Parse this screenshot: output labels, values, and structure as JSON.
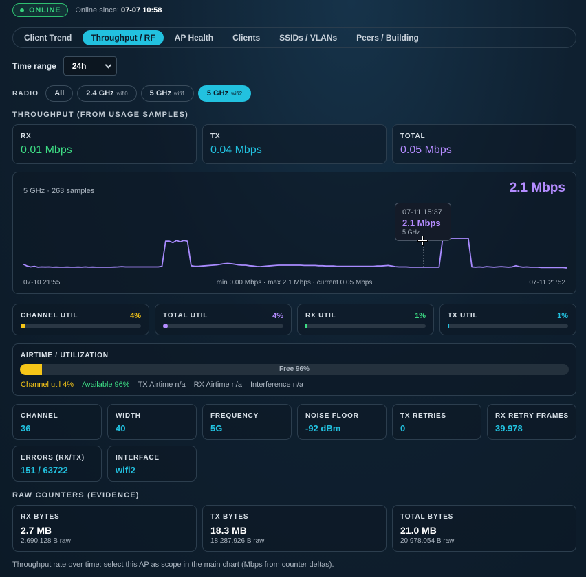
{
  "status": {
    "badge": "ONLINE",
    "since_label": "Online since:",
    "since_value": "07-07 10:58"
  },
  "tabs": [
    {
      "label": "Client Trend",
      "active": false
    },
    {
      "label": "Throughput / RF",
      "active": true
    },
    {
      "label": "AP Health",
      "active": false
    },
    {
      "label": "Clients",
      "active": false
    },
    {
      "label": "SSIDs / VLANs",
      "active": false
    },
    {
      "label": "Peers / Building",
      "active": false
    }
  ],
  "time_range": {
    "label": "Time range",
    "value": "24h"
  },
  "radio": {
    "label": "RADIO",
    "options": [
      {
        "label": "All",
        "sub": "",
        "active": false
      },
      {
        "label": "2.4 GHz",
        "sub": "wifi0",
        "active": false
      },
      {
        "label": "5 GHz",
        "sub": "wifi1",
        "active": false
      },
      {
        "label": "5 GHz",
        "sub": "wifi2",
        "active": true
      }
    ]
  },
  "throughput": {
    "title": "THROUGHPUT (FROM USAGE SAMPLES)",
    "rx": {
      "label": "RX",
      "value": "0.01 Mbps",
      "color": "#3ddc84"
    },
    "tx": {
      "label": "TX",
      "value": "0.04 Mbps",
      "color": "#22c1df"
    },
    "total": {
      "label": "TOTAL",
      "value": "0.05 Mbps",
      "color": "#b48cff"
    }
  },
  "chart": {
    "subtitle": "5 GHz · 263 samples",
    "peak": "2.1 Mbps",
    "tooltip": {
      "time": "07-11 15:37",
      "value": "2.1 Mbps",
      "band": "5 GHz"
    },
    "footer_left": "07-10 21:55",
    "footer_center": "min 0.00 Mbps · max 2.1 Mbps · current 0.05 Mbps",
    "footer_right": "07-11 21:52"
  },
  "chart_data": {
    "type": "line",
    "series": [
      {
        "values": [
          0.3,
          0.18,
          0.12,
          0.16,
          0.1,
          0.12,
          0.11,
          0.12,
          0.1,
          0.11,
          0.1,
          0.1,
          0.11,
          0.1,
          0.1,
          0.11,
          0.1,
          0.12,
          0.1,
          0.11,
          0.1,
          0.1,
          0.1,
          0.1,
          0.1,
          0.11,
          0.12,
          0.14,
          0.12,
          0.12,
          0.12,
          0.12,
          0.12,
          0.12,
          0.12,
          0.12,
          0.12,
          0.12,
          0.16,
          1.9,
          1.9,
          1.8,
          1.95,
          1.85,
          1.95,
          1.9,
          0.2,
          0.16,
          0.16,
          0.18,
          0.2,
          0.22,
          0.24,
          0.26,
          0.3,
          0.34,
          0.36,
          0.34,
          0.3,
          0.26,
          0.24,
          0.24,
          0.2,
          0.18,
          0.15,
          0.14,
          0.16,
          0.18,
          0.2,
          0.22,
          0.24,
          0.24,
          0.24,
          0.24,
          0.24,
          0.24,
          0.24,
          0.22,
          0.22,
          0.22,
          0.22,
          0.2,
          0.2,
          0.18,
          0.18,
          0.18,
          0.16,
          0.16,
          0.16,
          0.16,
          0.16,
          0.16,
          0.16,
          0.16,
          0.16,
          0.16,
          0.16,
          0.18,
          0.18,
          0.2,
          0.22,
          0.18,
          0.14,
          0.12,
          0.12,
          0.12,
          0.1,
          0.1,
          0.1,
          0.1,
          0.1,
          0.1,
          0.1,
          0.1,
          0.1,
          2.1,
          2.1,
          2.1,
          2.1,
          2.1,
          2.1,
          2.1,
          2.1,
          0.12,
          0.1,
          0.12,
          0.1,
          0.14,
          0.12,
          0.1,
          0.12,
          0.14,
          0.12,
          0.1,
          0.12,
          0.2,
          0.14,
          0.1,
          0.12,
          0.1,
          0.1,
          0.1,
          0.08,
          0.08,
          0.08,
          0.08,
          0.08,
          0.08,
          0.08,
          0.05
        ],
        "color": "#a98bff"
      }
    ],
    "x_start": "07-10 21:55",
    "x_end": "07-11 21:52",
    "ylim": [
      0,
      2.1
    ]
  },
  "util": [
    {
      "label": "CHANNEL UTIL",
      "pct": "4%",
      "value": 4,
      "color": "#f5c518"
    },
    {
      "label": "TOTAL UTIL",
      "pct": "4%",
      "value": 4,
      "color": "#b48cff"
    },
    {
      "label": "RX UTIL",
      "pct": "1%",
      "value": 1,
      "color": "#3ddc84"
    },
    {
      "label": "TX UTIL",
      "pct": "1%",
      "value": 1,
      "color": "#22c1df"
    }
  ],
  "airtime": {
    "title": "AIRTIME / UTILIZATION",
    "used": 4,
    "free_label": "Free 96%",
    "legend": [
      {
        "text": "Channel util 4%",
        "color": "#f5c518"
      },
      {
        "text": "Available 96%",
        "color": "#3ddc84"
      },
      {
        "text": "TX Airtime n/a",
        "color": "#aab4bf"
      },
      {
        "text": "RX Airtime n/a",
        "color": "#aab4bf"
      },
      {
        "text": "Interference n/a",
        "color": "#aab4bf"
      }
    ]
  },
  "stats": [
    {
      "label": "CHANNEL",
      "value": "36"
    },
    {
      "label": "WIDTH",
      "value": "40"
    },
    {
      "label": "FREQUENCY",
      "value": "5G"
    },
    {
      "label": "NOISE FLOOR",
      "value": "-92 dBm"
    },
    {
      "label": "TX RETRIES",
      "value": "0"
    },
    {
      "label": "RX RETRY FRAMES",
      "value": "39.978"
    },
    {
      "label": "ERRORS (RX/TX)",
      "value": "151 / 63722"
    },
    {
      "label": "INTERFACE",
      "value": "wifi2"
    }
  ],
  "raw": {
    "title": "RAW COUNTERS (EVIDENCE)",
    "items": [
      {
        "label": "RX BYTES",
        "main": "2.7 MB",
        "sub": "2.690.128 B raw"
      },
      {
        "label": "TX BYTES",
        "main": "18.3 MB",
        "sub": "18.287.926 B raw"
      },
      {
        "label": "TOTAL BYTES",
        "main": "21.0 MB",
        "sub": "20.978.054 B raw"
      }
    ]
  },
  "footnote": "Throughput rate over time: select this AP as scope in the main chart (Mbps from counter deltas)."
}
